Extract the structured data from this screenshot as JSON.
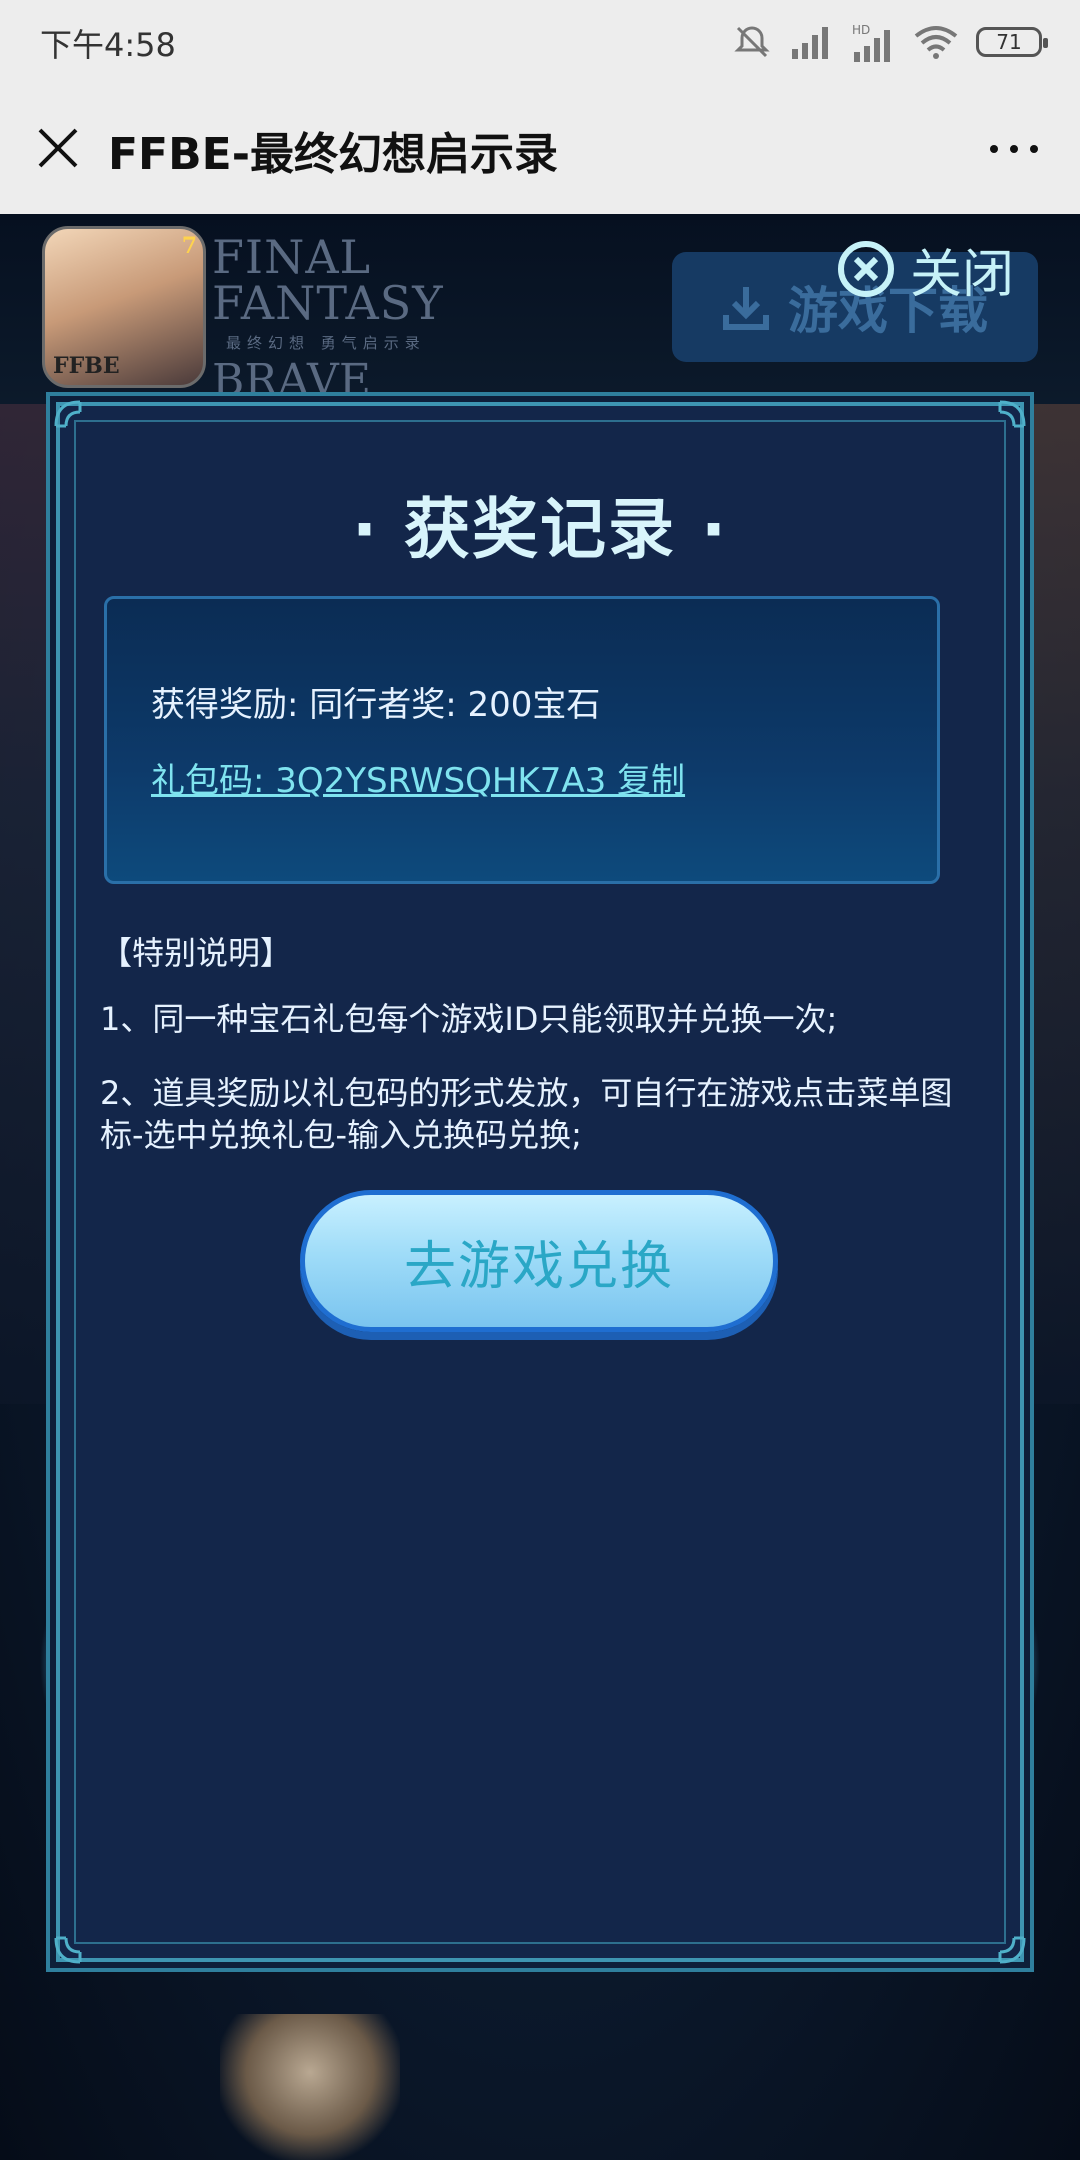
{
  "status_bar": {
    "time": "下午4:58",
    "battery": "71",
    "icons": [
      "mute-icon",
      "signal-icon",
      "hd-signal-icon",
      "wifi-icon",
      "battery-icon"
    ]
  },
  "nav": {
    "title": "FFBE-最终幻想启示录",
    "close_icon": "close-icon",
    "more_icon": "more-icon"
  },
  "banner": {
    "app_icon_text": "FFBE",
    "app_icon_badge": "7",
    "logo_line1": "FINAL FANTASY",
    "logo_line2": "最终幻想 勇气启示录",
    "logo_line3": "BRAVE EXVIUS",
    "download_label": "游戏下载",
    "close_label": "关闭"
  },
  "modal": {
    "title": "· 获奖记录 ·",
    "reward_text": "获得奖励: 同行者奖: 200宝石",
    "gift_code_text": "礼包码: 3Q2YSRWSQHK7A3 复制",
    "notes_title": "【特别说明】",
    "note1": "1、同一种宝石礼包每个游戏ID只能领取并兑换一次;",
    "note2": "2、道具奖励以礼包码的形式发放，可自行在游戏点击菜单图标-选中兑换礼包-输入兑换码兑换;",
    "exchange_button": "去游戏兑换"
  },
  "colors": {
    "modal_bg": "#13264a",
    "frame": "#3e95b2",
    "accent_text": "#7fe3ef",
    "button_border": "#1f6ed1"
  }
}
